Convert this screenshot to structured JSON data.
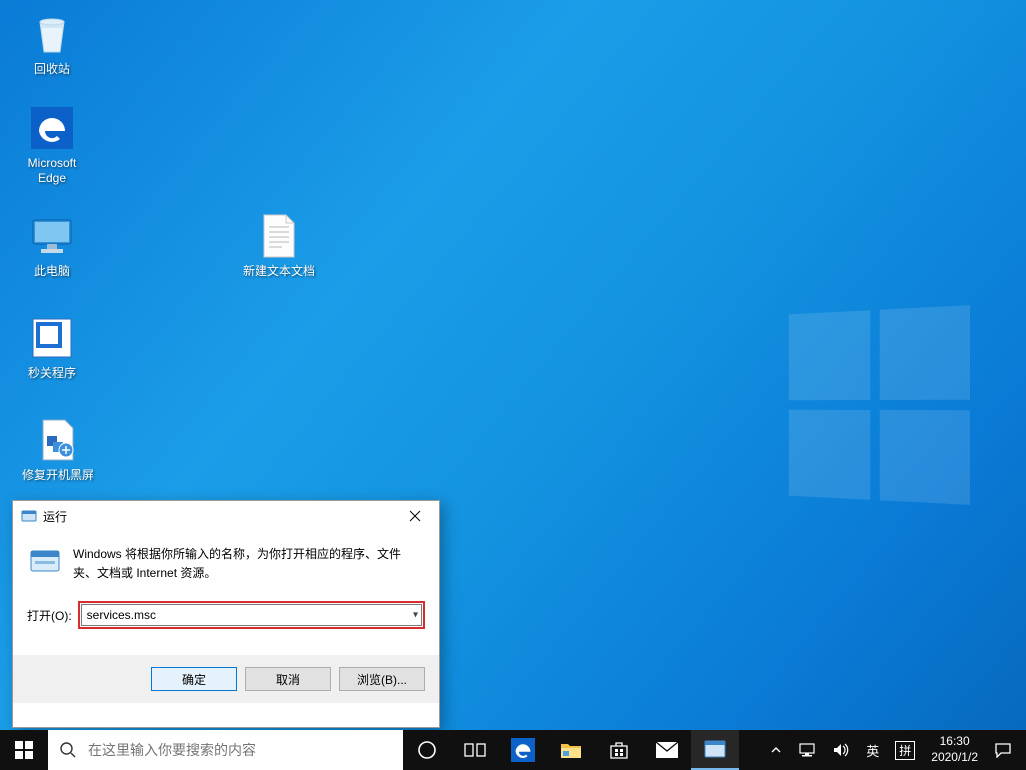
{
  "desktop": {
    "icons": [
      {
        "name": "recycle-bin",
        "label": "回收站"
      },
      {
        "name": "edge",
        "label": "Microsoft Edge"
      },
      {
        "name": "this-pc",
        "label": "此电脑"
      },
      {
        "name": "shutdown-app",
        "label": "秒关程序"
      },
      {
        "name": "fix-black-screen",
        "label": "修复开机黑屏"
      },
      {
        "name": "text-file",
        "label": "新建文本文档"
      }
    ]
  },
  "run_dialog": {
    "title": "运行",
    "description": "Windows 将根据你所输入的名称，为你打开相应的程序、文件夹、文档或 Internet 资源。",
    "open_label": "打开(O):",
    "open_value": "services.msc",
    "ok": "确定",
    "cancel": "取消",
    "browse": "浏览(B)..."
  },
  "taskbar": {
    "search_placeholder": "在这里输入你要搜索的内容",
    "ime_lang": "英",
    "ime_mode": "拼",
    "time": "16:30",
    "date": "2020/1/2"
  }
}
